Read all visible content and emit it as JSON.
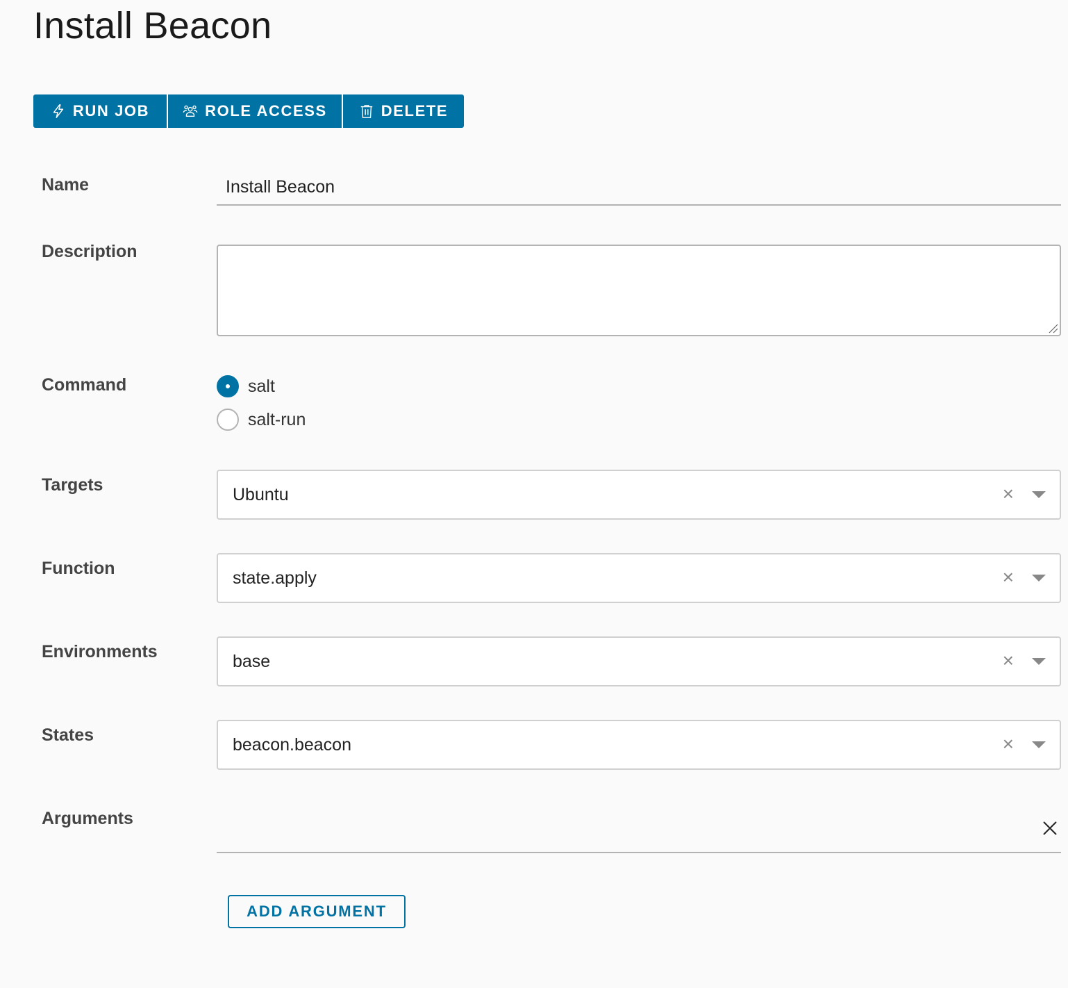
{
  "page": {
    "title": "Install Beacon"
  },
  "toolbar": {
    "run_job": "RUN JOB",
    "role_access": "ROLE ACCESS",
    "delete": "DELETE"
  },
  "form": {
    "name": {
      "label": "Name",
      "value": "Install Beacon"
    },
    "description": {
      "label": "Description",
      "value": ""
    },
    "command": {
      "label": "Command",
      "options": [
        {
          "label": "salt",
          "selected": true
        },
        {
          "label": "salt-run",
          "selected": false
        }
      ]
    },
    "targets": {
      "label": "Targets",
      "value": "Ubuntu"
    },
    "function": {
      "label": "Function",
      "value": "state.apply"
    },
    "environments": {
      "label": "Environments",
      "value": "base"
    },
    "states": {
      "label": "States",
      "value": "beacon.beacon"
    },
    "arguments": {
      "label": "Arguments"
    },
    "add_argument": "ADD ARGUMENT"
  },
  "icons": {
    "clear": "close-icon",
    "dropdown": "caret-down-icon"
  },
  "colors": {
    "primary": "#0072a3",
    "border": "#b3b3b3"
  }
}
